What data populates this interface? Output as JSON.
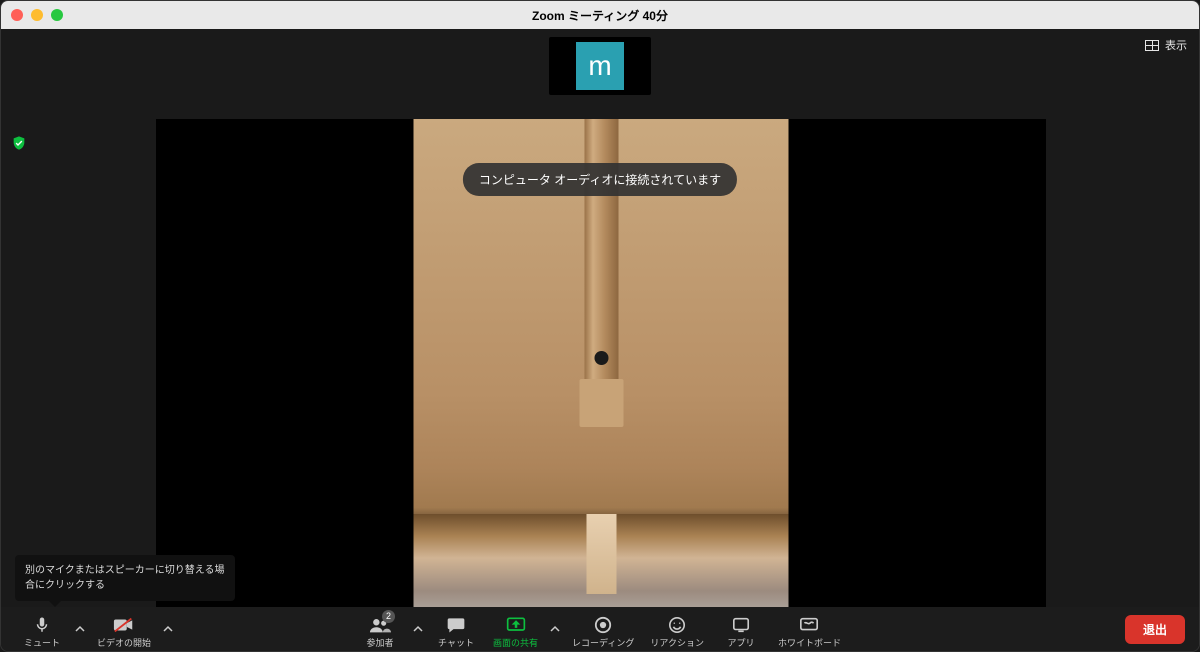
{
  "title": "Zoom ミーティング  40分",
  "thumbnail": {
    "initial": "m"
  },
  "view_toggle_label": "表示",
  "toast": "コンピュータ オーディオに接続されています",
  "tooltip": "別のマイクまたはスピーカーに切り替える場合にクリックする",
  "toolbar": {
    "mute": "ミュート",
    "video": "ビデオの開始",
    "participants": "参加者",
    "participants_count": "2",
    "chat": "チャット",
    "share": "画面の共有",
    "record": "レコーディング",
    "reactions": "リアクション",
    "apps": "アプリ",
    "whiteboard": "ホワイトボード",
    "leave": "退出"
  }
}
